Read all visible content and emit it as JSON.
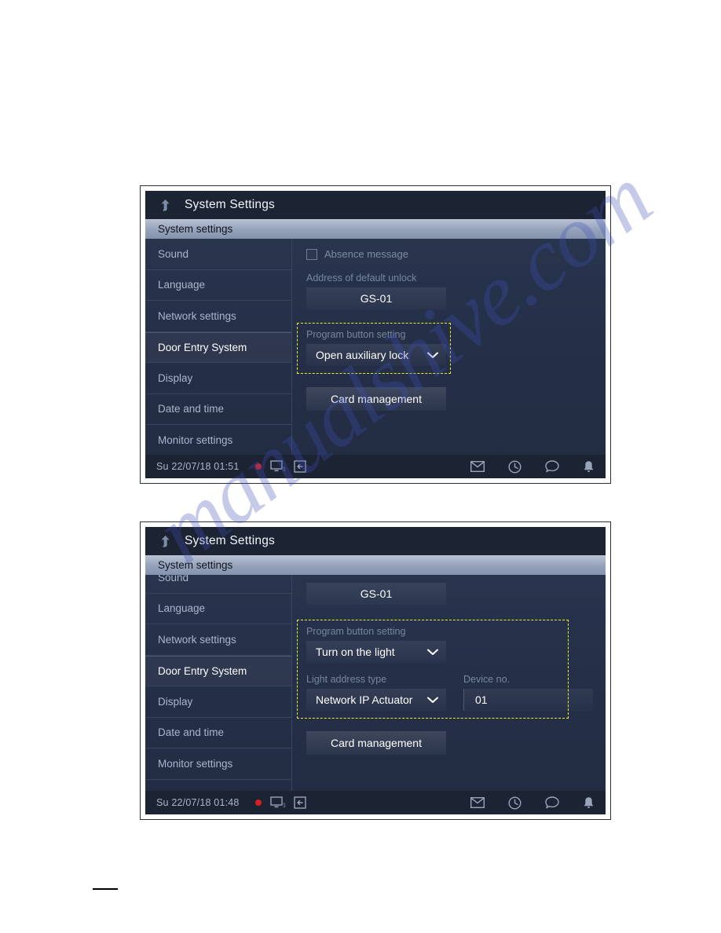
{
  "watermark": {
    "text": "manualshive.com"
  },
  "panels": [
    {
      "id": "panel-top",
      "titlebar": {
        "title": "System Settings",
        "back_icon": "back-arrow-icon"
      },
      "section_bar": {
        "label": "System settings"
      },
      "sidebar": {
        "items": [
          {
            "label": "Sound",
            "active": false
          },
          {
            "label": "Language",
            "active": false
          },
          {
            "label": "Network settings",
            "active": false
          },
          {
            "label": "Door Entry System",
            "active": true
          },
          {
            "label": "Display",
            "active": false
          },
          {
            "label": "Date and time",
            "active": false
          },
          {
            "label": "Monitor settings",
            "active": false
          }
        ]
      },
      "content": {
        "absence_message": {
          "label": "Absence message",
          "checked": false
        },
        "default_unlock": {
          "label": "Address of default unlock",
          "value": "GS-01"
        },
        "program_button": {
          "label": "Program button setting",
          "value": "Open auxiliary lock"
        },
        "card_management": {
          "label": "Card management"
        }
      },
      "statusbar": {
        "datetime": "Su 22/07/18  01:51",
        "record_indicator": "record-dot-icon",
        "monitor_icon": "monitor-icon",
        "monitor_count": "1",
        "transfer_icon": "transfer-icon",
        "right_icons": [
          "mail-icon",
          "history-icon",
          "message-icon",
          "bell-icon"
        ]
      }
    },
    {
      "id": "panel-bottom",
      "titlebar": {
        "title": "System Settings",
        "back_icon": "back-arrow-icon"
      },
      "section_bar": {
        "label": "System settings"
      },
      "sidebar": {
        "items": [
          {
            "label": "Sound",
            "active": false
          },
          {
            "label": "Language",
            "active": false
          },
          {
            "label": "Network settings",
            "active": false
          },
          {
            "label": "Door Entry System",
            "active": true
          },
          {
            "label": "Display",
            "active": false
          },
          {
            "label": "Date and time",
            "active": false
          },
          {
            "label": "Monitor settings",
            "active": false
          }
        ]
      },
      "content": {
        "default_unlock": {
          "value": "GS-01"
        },
        "program_button": {
          "label": "Program button setting",
          "value": "Turn on the light"
        },
        "light_address_type": {
          "label": "Light address type",
          "value": "Network IP Actuator"
        },
        "device_no": {
          "label": "Device no.",
          "value": "01"
        },
        "card_management": {
          "label": "Card management"
        }
      },
      "statusbar": {
        "datetime": "Su 22/07/18  01:48",
        "record_indicator": "record-dot-icon",
        "monitor_icon": "monitor-icon",
        "monitor_count": "1",
        "transfer_icon": "transfer-icon",
        "right_icons": [
          "mail-icon",
          "history-icon",
          "message-icon",
          "bell-icon"
        ]
      }
    }
  ],
  "colors": {
    "highlight": "#efef22",
    "record": "#d81f1f",
    "screen_dark": "#1c2333",
    "section_bar": "#94a1ba"
  }
}
